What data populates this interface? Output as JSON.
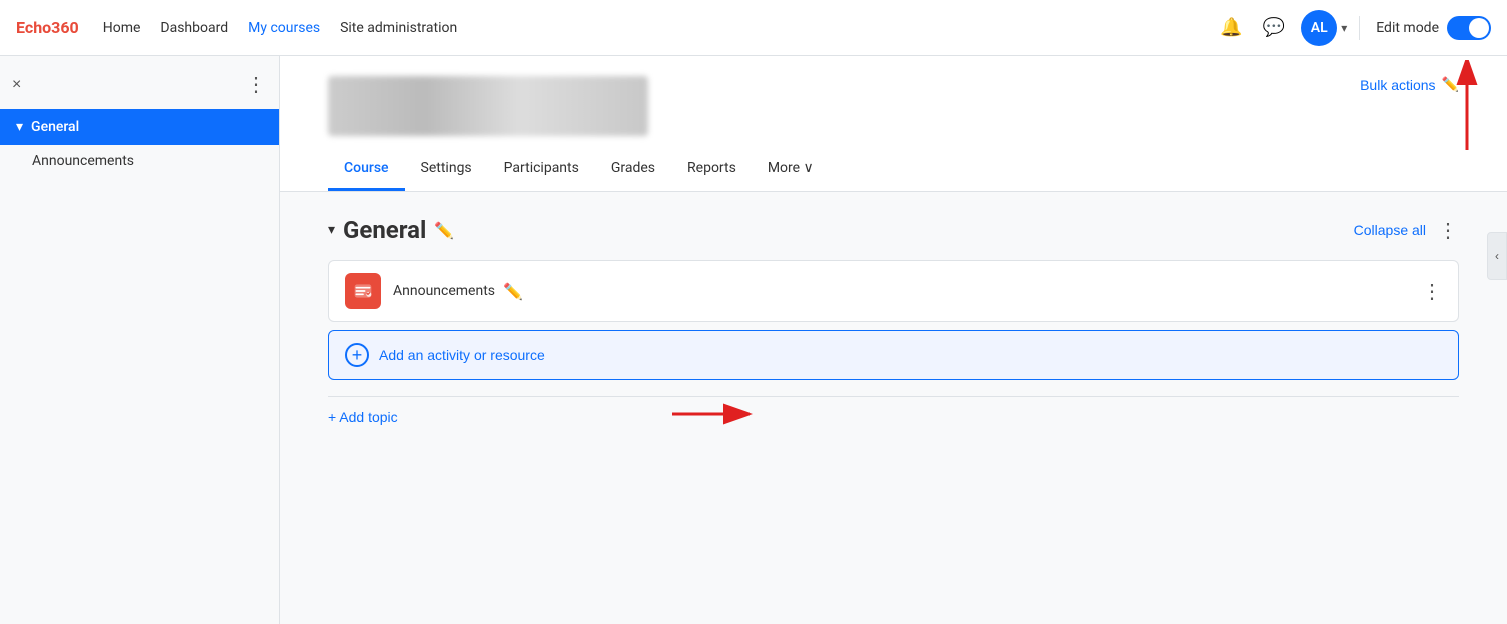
{
  "topnav": {
    "logo": "Echo360",
    "links": [
      {
        "label": "Home",
        "active": false
      },
      {
        "label": "Dashboard",
        "active": false
      },
      {
        "label": "My courses",
        "active": false
      },
      {
        "label": "Site administration",
        "active": false
      }
    ],
    "avatar_initials": "AL",
    "edit_mode_label": "Edit mode"
  },
  "sidebar": {
    "close_label": "×",
    "menu_label": "⋮",
    "section_label": "General",
    "items": [
      {
        "label": "Announcements"
      }
    ]
  },
  "course_header": {
    "bulk_actions_label": "Bulk actions"
  },
  "tabs": [
    {
      "label": "Course",
      "active": true
    },
    {
      "label": "Settings",
      "active": false
    },
    {
      "label": "Participants",
      "active": false
    },
    {
      "label": "Grades",
      "active": false
    },
    {
      "label": "Reports",
      "active": false
    },
    {
      "label": "More ∨",
      "active": false
    }
  ],
  "section": {
    "title": "General",
    "collapse_all_label": "Collapse all",
    "activity": {
      "name": "Announcements"
    },
    "add_activity_label": "Add an activity or resource",
    "add_topic_label": "+ Add topic"
  }
}
